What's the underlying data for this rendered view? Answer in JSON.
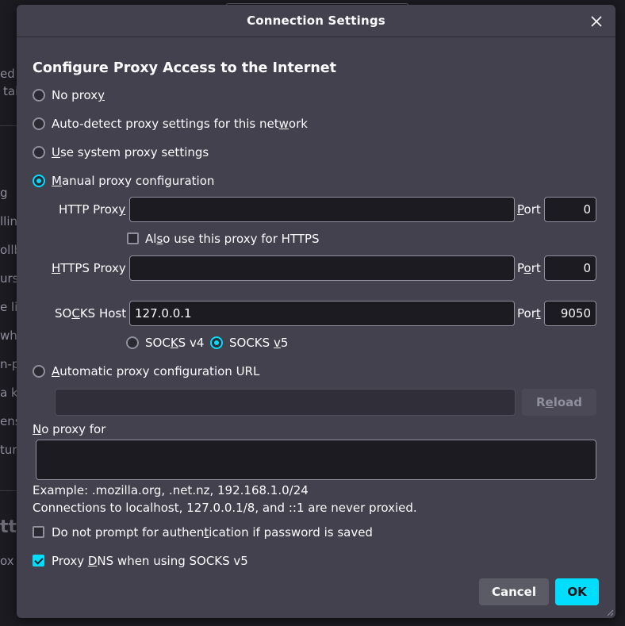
{
  "background": {
    "fragments": [
      "ed",
      "tai",
      "g",
      "llin",
      "ollb",
      "urs",
      "e lin",
      "whe",
      "n-pi",
      "a k",
      "ens",
      "ture",
      "tti",
      "ox o"
    ]
  },
  "dialog": {
    "title": "Connection Settings",
    "close_icon": "close-icon",
    "heading": "Configure Proxy Access to the Internet",
    "proxy_mode": {
      "selected": "manual",
      "no_proxy": {
        "pre": "No prox",
        "key": "y",
        "post": ""
      },
      "auto_detect": {
        "pre": "Auto-detect proxy settings for this net",
        "key": "w",
        "post": "ork"
      },
      "system": {
        "pre": "",
        "key": "U",
        "post": "se system proxy settings"
      },
      "manual": {
        "pre": "",
        "key": "M",
        "post": "anual proxy configuration"
      },
      "auto_url": {
        "pre": "",
        "key": "A",
        "post": "utomatic proxy configuration URL"
      }
    },
    "http": {
      "label": {
        "pre": "HTTP Prox",
        "key": "y",
        "post": ""
      },
      "value": "",
      "port_label": {
        "pre": "",
        "key": "P",
        "post": "ort"
      },
      "port": "0"
    },
    "also_https": {
      "pre": "Al",
      "key": "s",
      "post": "o use this proxy for HTTPS",
      "checked": false
    },
    "https": {
      "label": {
        "pre": "",
        "key": "H",
        "post": "TTPS Proxy"
      },
      "value": "",
      "port_label": {
        "pre": "P",
        "key": "o",
        "post": "rt"
      },
      "port": "0"
    },
    "socks": {
      "label": {
        "pre": "SO",
        "key": "C",
        "post": "KS Host"
      },
      "value": "127.0.0.1",
      "port_label": {
        "pre": "Por",
        "key": "t",
        "post": ""
      },
      "port": "9050",
      "version_selected": "v5",
      "v4": {
        "pre": "SOC",
        "key": "K",
        "post": "S v4"
      },
      "v5": {
        "pre": "SOCKS ",
        "key": "v",
        "post": "5"
      }
    },
    "auto_url_value": "",
    "reload_button": {
      "pre": "R",
      "key": "e",
      "post": "load"
    },
    "no_proxy_for": {
      "pre": "",
      "key": "N",
      "post": "o proxy for"
    },
    "no_proxy_value": "",
    "example_text": "Example: .mozilla.org, .net.nz, 192.168.1.0/24",
    "localhost_note": "Connections to localhost, 127.0.0.1/8, and ::1 are never proxied.",
    "no_auth_prompt": {
      "pre": "Do not prompt for authen",
      "key": "t",
      "post": "ication if password is saved",
      "checked": false
    },
    "proxy_dns": {
      "pre": "Proxy ",
      "key": "D",
      "post": "NS when using SOCKS v5",
      "checked": true
    },
    "cancel_button": "Cancel",
    "ok_button": "OK"
  },
  "colors": {
    "dialog_bg": "#42414d",
    "page_bg": "#1c1b22",
    "accent": "#00ddff",
    "input_bg": "#1c1b22",
    "muted_text": "#8f8f9d"
  }
}
